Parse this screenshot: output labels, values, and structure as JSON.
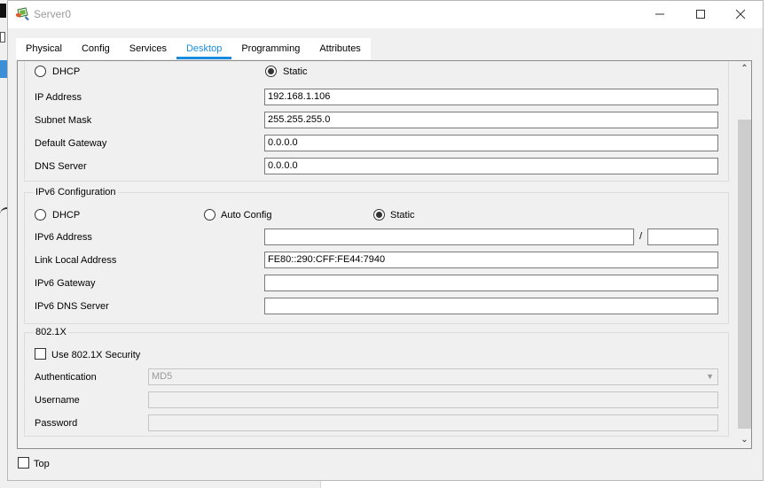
{
  "window": {
    "title": "Server0"
  },
  "tabs": [
    "Physical",
    "Config",
    "Services",
    "Desktop",
    "Programming",
    "Attributes"
  ],
  "ipv4": {
    "dhcp_label": "DHCP",
    "static_label": "Static",
    "mode": "Static",
    "ip_label": "IP Address",
    "ip_value": "192.168.1.106",
    "mask_label": "Subnet Mask",
    "mask_value": "255.255.255.0",
    "gateway_label": "Default Gateway",
    "gateway_value": "0.0.0.0",
    "dns_label": "DNS Server",
    "dns_value": "0.0.0.0"
  },
  "ipv6": {
    "title": "IPv6 Configuration",
    "dhcp_label": "DHCP",
    "auto_label": "Auto Config",
    "static_label": "Static",
    "mode": "Static",
    "address_label": "IPv6 Address",
    "address_value": "",
    "prefix_separator": "/",
    "prefix_value": "",
    "link_local_label": "Link Local Address",
    "link_local_value": "FE80::290:CFF:FE44:7940",
    "gateway_label": "IPv6 Gateway",
    "gateway_value": "",
    "dns_label": "IPv6 DNS Server",
    "dns_value": ""
  },
  "dot1x": {
    "title": "802.1X",
    "use_security_label": "Use 802.1X Security",
    "use_security_checked": false,
    "auth_label": "Authentication",
    "auth_value": "MD5",
    "username_label": "Username",
    "username_value": "",
    "password_label": "Password",
    "password_value": ""
  },
  "footer": {
    "top_label": "Top",
    "top_checked": false
  },
  "colors": {
    "accent": "#1a8ce0",
    "window_bg": "#f0f0f0",
    "field_border": "#7a7a7a"
  }
}
